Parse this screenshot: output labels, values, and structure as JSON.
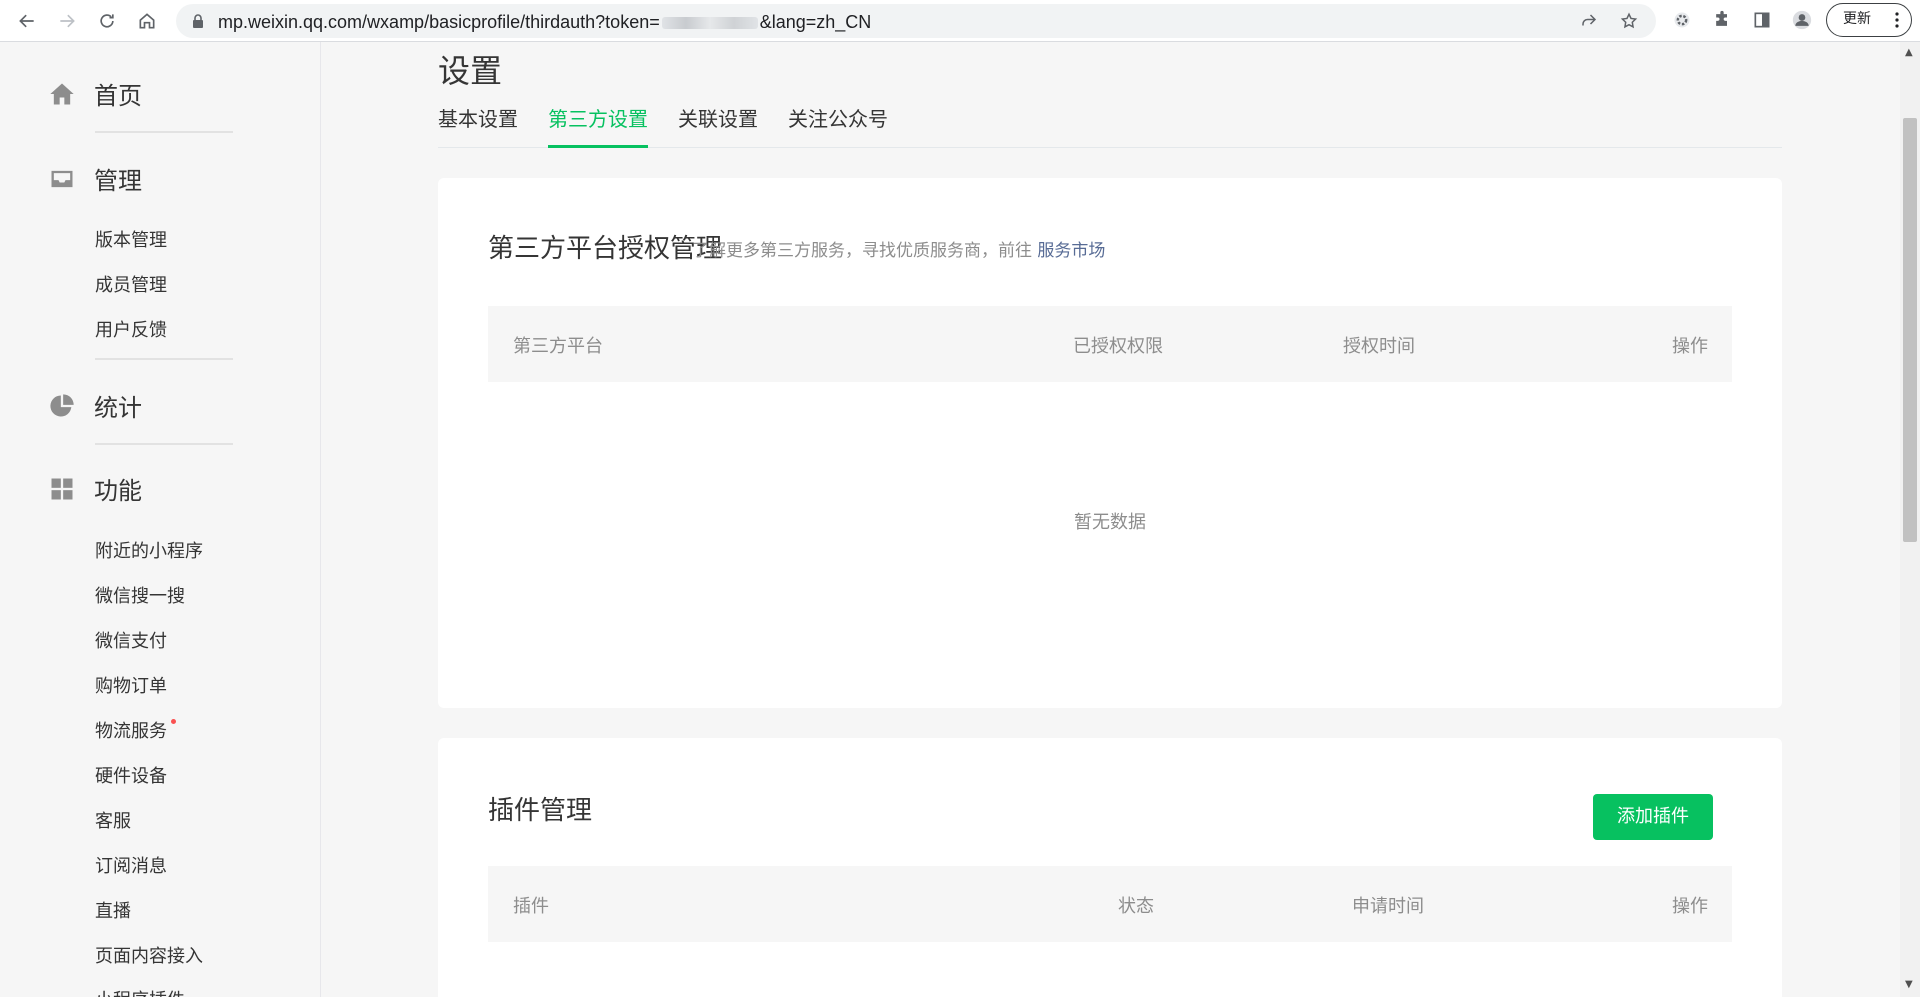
{
  "browser": {
    "url_prefix": "mp.weixin.qq.com/wxamp/basicprofile/thirdauth?token=",
    "url_suffix": "&lang=zh_CN",
    "update_label": "更新"
  },
  "sidebar": {
    "home": "首页",
    "manage": {
      "label": "管理",
      "items": [
        "版本管理",
        "成员管理",
        "用户反馈"
      ]
    },
    "stats": "统计",
    "features": {
      "label": "功能",
      "items": [
        "附近的小程序",
        "微信搜一搜",
        "微信支付",
        "购物订单",
        "物流服务",
        "硬件设备",
        "客服",
        "订阅消息",
        "直播",
        "页面内容接入",
        "小程序插件"
      ]
    }
  },
  "page": {
    "title": "设置",
    "tabs": [
      "基本设置",
      "第三方设置",
      "关联设置",
      "关注公众号"
    ],
    "active_tab": "第三方设置"
  },
  "third_party": {
    "title": "第三方平台授权管理",
    "desc": "了解更多第三方服务，寻找优质服务商，前往",
    "link": "服务市场",
    "columns": [
      "第三方平台",
      "已授权权限",
      "授权时间",
      "操作"
    ],
    "empty": "暂无数据"
  },
  "plugins": {
    "title": "插件管理",
    "add_button": "添加插件",
    "columns": [
      "插件",
      "状态",
      "申请时间",
      "操作"
    ]
  },
  "colors": {
    "accent": "#07c160",
    "link": "#576b95",
    "badge": "#fa5151"
  }
}
